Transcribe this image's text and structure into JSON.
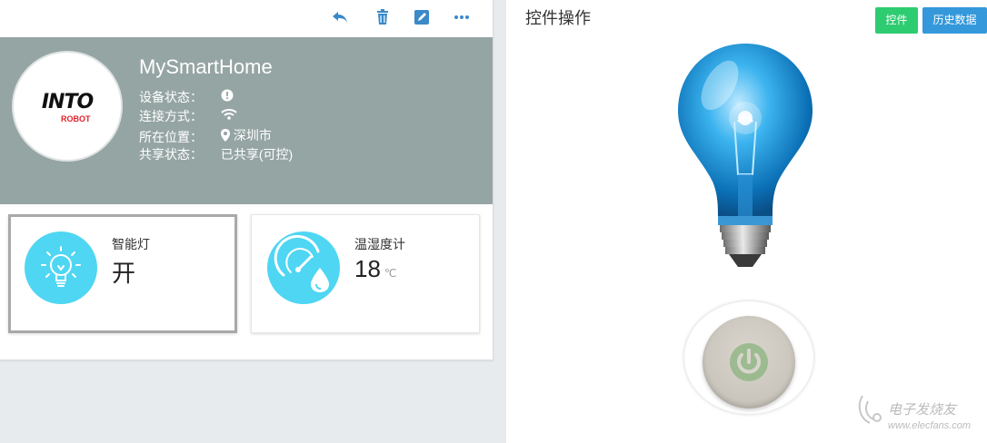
{
  "toolbar": {
    "icons": [
      "reply-icon",
      "trash-icon",
      "edit-icon",
      "more-icon"
    ],
    "accent": "#3a89c9"
  },
  "device": {
    "name": "MySmartHome",
    "logo": {
      "text": "INTO",
      "sub": "ROBOT"
    },
    "info": [
      {
        "label": "设备状态：",
        "icon": "alert-icon",
        "value": ""
      },
      {
        "label": "连接方式：",
        "icon": "wifi-icon",
        "value": ""
      },
      {
        "label": "所在位置：",
        "icon": "location-icon",
        "value": "深圳市"
      },
      {
        "label": "共享状态：",
        "icon": "",
        "value": "已共享(可控)"
      }
    ],
    "header_color": "#95a5a3"
  },
  "widgets": [
    {
      "title": "智能灯",
      "value": "开",
      "unit": "",
      "icon": "bulb-icon"
    },
    {
      "title": "温湿度计",
      "value": "18",
      "unit": "℃",
      "icon": "gauge-drop-icon"
    }
  ],
  "control": {
    "title": "控件操作",
    "tabs": [
      {
        "label": "控件",
        "color": "#2ecc71"
      },
      {
        "label": "历史数据",
        "color": "#3498db"
      }
    ],
    "power_icon": "power-icon"
  },
  "watermark": {
    "title": "电子发烧友",
    "url": "www.elecfans.com"
  }
}
